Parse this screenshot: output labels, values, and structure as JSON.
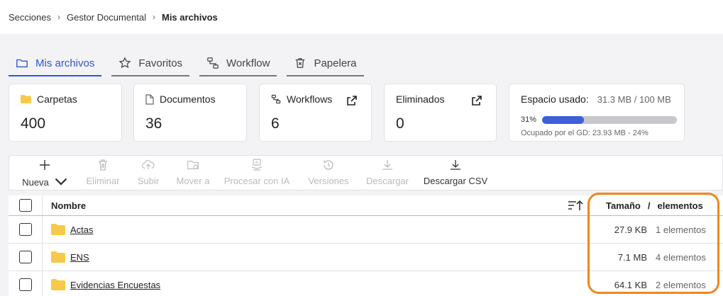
{
  "breadcrumb": {
    "items": [
      "Secciones",
      "Gestor Documental"
    ],
    "current": "Mis archivos",
    "separator": "›"
  },
  "tabs": [
    {
      "label": "Mis archivos",
      "icon": "folder-icon",
      "active": true
    },
    {
      "label": "Favoritos",
      "icon": "star-icon",
      "active": false
    },
    {
      "label": "Workflow",
      "icon": "workflow-icon",
      "active": false
    },
    {
      "label": "Papelera",
      "icon": "trash-icon",
      "active": false
    }
  ],
  "cards": {
    "carpetas": {
      "label": "Carpetas",
      "value": "400"
    },
    "documentos": {
      "label": "Documentos",
      "value": "36"
    },
    "workflows": {
      "label": "Workflows",
      "value": "6"
    },
    "eliminados": {
      "label": "Eliminados",
      "value": "0"
    },
    "espacio": {
      "label": "Espacio usado:",
      "sub": "31.3 MB / 100 MB",
      "percent_label": "31%",
      "percent": 31,
      "gd": "Ocupado por el GD: 23.93 MB - 24%"
    }
  },
  "toolbar": {
    "nueva": "Nueva",
    "eliminar": "Eliminar",
    "subir": "Subir",
    "mover": "Mover a",
    "procesar": "Procesar con IA",
    "versiones": "Versiones",
    "descargar": "Descargar",
    "descargar_csv": "Descargar CSV"
  },
  "table": {
    "col_name": "Nombre",
    "col_size": "Tamaño",
    "col_slash": "/",
    "col_elements": "elementos",
    "rows": [
      {
        "name": "Actas",
        "size": "27.9 KB",
        "elements": "1 elementos"
      },
      {
        "name": "ENS",
        "size": "7.1 MB",
        "elements": "4 elementos"
      },
      {
        "name": "Evidencias Encuestas",
        "size": "64.1 KB",
        "elements": "2 elementos"
      }
    ]
  },
  "colors": {
    "accent": "#2f55d4",
    "folder": "#f7c948",
    "highlight": "#f0861f",
    "progress": "#3d5fd9"
  }
}
